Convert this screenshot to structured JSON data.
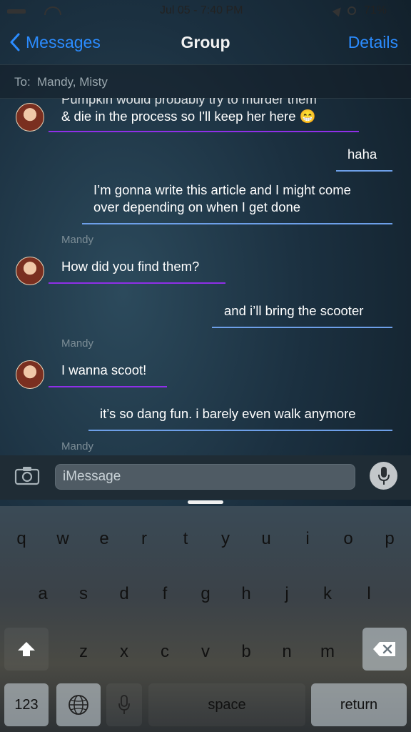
{
  "status_bar": {
    "time": "Jul 05 - 7:40 PM",
    "battery": "71%"
  },
  "nav": {
    "back_label": "Messages",
    "title": "Group",
    "details_label": "Details"
  },
  "to_bar": {
    "label": "To:",
    "recipients": "Mandy, Misty"
  },
  "messages": [
    {
      "text_a": "Pumpkin would probably try to murder them",
      "text_b": "& die in the process so I'll keep her here 😁"
    },
    {
      "text": "haha"
    },
    {
      "text_a": "I’m gonna write this article and I might come",
      "text_b": "over depending on when I get done"
    },
    {
      "sender": "Mandy"
    },
    {
      "text": "How did you find them?"
    },
    {
      "text": "and i’ll bring the scooter"
    },
    {
      "sender": "Mandy"
    },
    {
      "text": "I wanna scoot!"
    },
    {
      "text": "it’s so dang fun. i barely even walk anymore"
    },
    {
      "sender": "Mandy"
    }
  ],
  "compose": {
    "placeholder": "iMessage"
  },
  "keyboard": {
    "row1": [
      "q",
      "w",
      "e",
      "r",
      "t",
      "y",
      "u",
      "i",
      "o",
      "p"
    ],
    "row2": [
      "a",
      "s",
      "d",
      "f",
      "g",
      "h",
      "j",
      "k",
      "l"
    ],
    "row3": [
      "z",
      "x",
      "c",
      "v",
      "b",
      "n",
      "m"
    ],
    "numbers_label": "123",
    "space_label": "space",
    "return_label": "return"
  },
  "colors": {
    "accent": "#2b8cff",
    "incoming_underline": "#8f2fe8",
    "outgoing_underline": "#6d9fe8"
  }
}
